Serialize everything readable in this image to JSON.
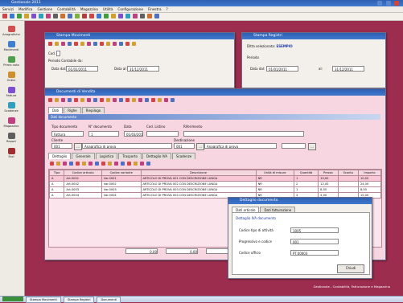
{
  "app": {
    "title": "Gestionale 2011"
  },
  "menu": [
    "Servizi",
    "Modifica",
    "Gestione",
    "Contabilità",
    "Magazzino",
    "Utilità",
    "Configurazione",
    "Finestra",
    "?"
  ],
  "sidebar": [
    {
      "label": "Anagrafiche",
      "color": "#d04f4f"
    },
    {
      "label": "Movimenti",
      "color": "#3f7fcf"
    },
    {
      "label": "Prima nota",
      "color": "#4f9f4f"
    },
    {
      "label": "Ordini",
      "color": "#cf8f2f"
    },
    {
      "label": "Fatture",
      "color": "#7f4fcf"
    },
    {
      "label": "Scadenze",
      "color": "#2f9fbf"
    },
    {
      "label": "Magazzino",
      "color": "#bf3f7f"
    },
    {
      "label": "Report",
      "color": "#5f5f5f"
    },
    {
      "label": "Esci",
      "color": "#9f2f2f"
    }
  ],
  "win_top_left": {
    "title": "Stampa Movimenti",
    "cod_label": "Cod.",
    "period_label": "Periodo Contabile da:",
    "date_from_label": "Data dal:",
    "date_from": "01/01/2011",
    "date_to_label": "Data al:",
    "date_to": "31/12/2011"
  },
  "win_top_right": {
    "title": "Stampa Registri",
    "company_label": "Ditta selezionata:",
    "company_value": "ESEMPIO",
    "period_label": "Periodo",
    "date_from_label": "Data dal:",
    "date_from": "01/01/2011",
    "date_to_label": "al:",
    "date_to": "31/12/2011"
  },
  "win_main": {
    "title": "Documenti di Vendita",
    "tabs_top": [
      "Dati",
      "Righe",
      "Riepilogo"
    ],
    "section_title": "Dati documento",
    "col_labels": [
      "Tipo documento",
      "N° documento",
      "Data",
      "Cod. Listino",
      "Riferimento"
    ],
    "doc_type": "Fattura",
    "doc_number": "1",
    "doc_date": "01/03/2011",
    "client_label": "Cliente",
    "client_code": "001",
    "client_name": "Anagrafica di prova",
    "dest_label": "Destinazione",
    "dest_code": "001",
    "dest_name": "Anagrafica di prova",
    "tabs_bottom": [
      "Dettaglio",
      "Generale",
      "Logistica",
      "Trasporto",
      "Dettaglio IVA",
      "Scadenze"
    ],
    "grid_headers": [
      "Tipo",
      "Codice articolo",
      "Codice variante",
      "Descrizione",
      "Unità di misura",
      "Quantità",
      "Prezzo",
      "Sconto",
      "Importo"
    ],
    "grid_rows": [
      [
        "A",
        "Art.0001",
        "Var.0001",
        "ARTICOLO DI PROVA 001 CON DESCRIZIONE LUNGA",
        "NR",
        "1",
        "10,00",
        "",
        "10,00"
      ],
      [
        "A",
        "Art.0002",
        "Var.0002",
        "ARTICOLO DI PROVA 002 CON DESCRIZIONE LUNGA",
        "NR",
        "2",
        "12,00",
        "",
        "24,00"
      ],
      [
        "A",
        "Art.0003",
        "Var.0003",
        "ARTICOLO DI PROVA 003 CON DESCRIZIONE LUNGA",
        "NR",
        "1",
        "8,50",
        "",
        "8,50"
      ],
      [
        "A",
        "Art.0004",
        "Var.0004",
        "ARTICOLO DI PROVA 004 CON DESCRIZIONE LUNGA",
        "NR",
        "3",
        "5,00",
        "",
        "15,00"
      ]
    ],
    "totals": [
      "0,00",
      "0,00",
      "0,00"
    ]
  },
  "dialog": {
    "title": "Dettaglio documento",
    "tabs": [
      "Dati articolo",
      "Dati fatturazione"
    ],
    "section": "Dettaglio IVA documento",
    "fields": [
      {
        "label": "Codice tipo di attività",
        "value": "1005"
      },
      {
        "label": "Progressivo e codice",
        "value": "001"
      },
      {
        "label": "Codice ufficio",
        "value": "PT.00003"
      }
    ],
    "close_label": "Chiudi"
  },
  "footer_text": "Gestionale - Contabilità, Fatturazione e Magazzino",
  "taskbar": {
    "items": [
      "Stampa Movimenti",
      "Stampa Registri",
      "Documenti"
    ]
  }
}
